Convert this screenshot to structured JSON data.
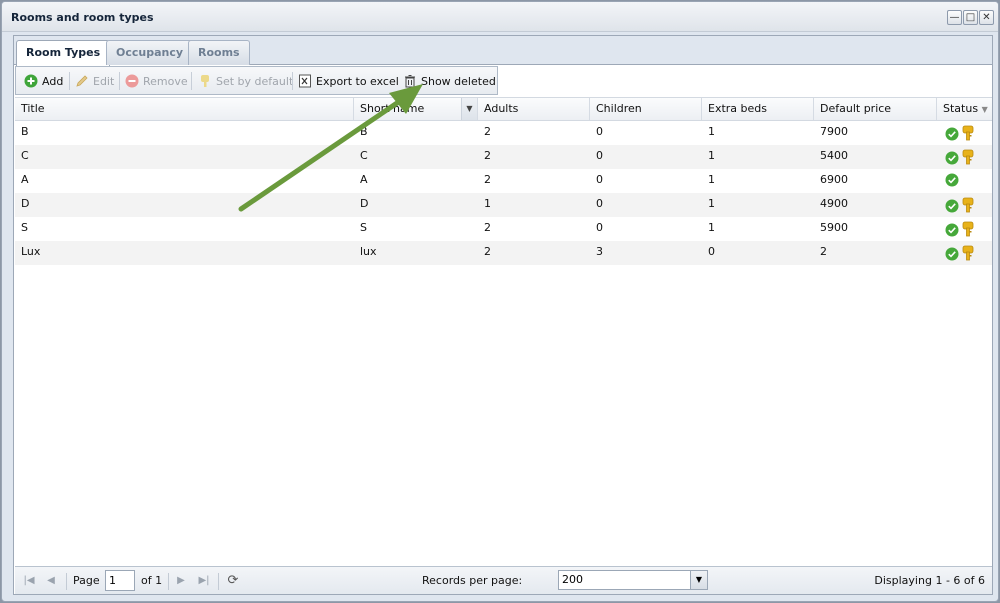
{
  "window": {
    "title": "Rooms and room types",
    "buttons": {
      "minimize": "—",
      "maximize": "□",
      "close": "✕"
    }
  },
  "tabs": [
    {
      "label": "Room Types",
      "active": true
    },
    {
      "label": "Occupancy",
      "active": false
    },
    {
      "label": "Rooms",
      "active": false
    }
  ],
  "toolbar": {
    "add": "Add",
    "edit": "Edit",
    "remove": "Remove",
    "set_default": "Set by default",
    "export": "Export to excel",
    "show_deleted": "Show deleted"
  },
  "columns": [
    "Title",
    "Short name",
    "Adults",
    "Children",
    "Extra beds",
    "Default price",
    "Status"
  ],
  "rows": [
    {
      "title": "B",
      "short": "B",
      "adults": "2",
      "children": "0",
      "extra": "1",
      "price": "7900",
      "key": true
    },
    {
      "title": "C",
      "short": "C",
      "adults": "2",
      "children": "0",
      "extra": "1",
      "price": "5400",
      "key": true
    },
    {
      "title": "A",
      "short": "A",
      "adults": "2",
      "children": "0",
      "extra": "1",
      "price": "6900",
      "key": false
    },
    {
      "title": "D",
      "short": "D",
      "adults": "1",
      "children": "0",
      "extra": "1",
      "price": "4900",
      "key": true
    },
    {
      "title": "S",
      "short": "S",
      "adults": "2",
      "children": "0",
      "extra": "1",
      "price": "5900",
      "key": true
    },
    {
      "title": "Lux",
      "short": "lux",
      "adults": "2",
      "children": "3",
      "extra": "0",
      "price": "2",
      "key": true
    }
  ],
  "pager": {
    "page_label": "Page",
    "page_value": "1",
    "of_label": "of 1",
    "rpp_label": "Records per page:",
    "rpp_value": "200",
    "display": "Displaying 1 - 6 of 6"
  },
  "colors": {
    "arrow": "#6a9a3c",
    "status_ok": "#46a83a",
    "key": "#e8b21a"
  }
}
